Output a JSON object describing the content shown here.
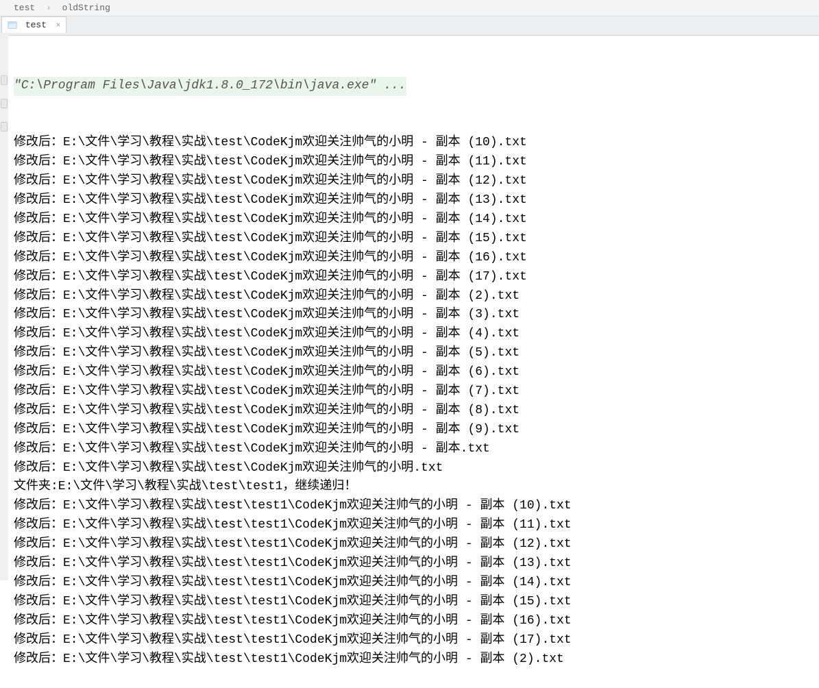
{
  "breadcrumb": {
    "item1": "test",
    "sep": "›",
    "item2": "oldString"
  },
  "tab": {
    "label": "test",
    "close_char": "×"
  },
  "console": {
    "command": "\"C:\\Program Files\\Java\\jdk1.8.0_172\\bin\\java.exe\" ...",
    "lines": [
      "修改后：E:\\文件\\学习\\教程\\实战\\test\\CodeKjm欢迎关注帅气的小明 - 副本 (10).txt",
      "修改后：E:\\文件\\学习\\教程\\实战\\test\\CodeKjm欢迎关注帅气的小明 - 副本 (11).txt",
      "修改后：E:\\文件\\学习\\教程\\实战\\test\\CodeKjm欢迎关注帅气的小明 - 副本 (12).txt",
      "修改后：E:\\文件\\学习\\教程\\实战\\test\\CodeKjm欢迎关注帅气的小明 - 副本 (13).txt",
      "修改后：E:\\文件\\学习\\教程\\实战\\test\\CodeKjm欢迎关注帅气的小明 - 副本 (14).txt",
      "修改后：E:\\文件\\学习\\教程\\实战\\test\\CodeKjm欢迎关注帅气的小明 - 副本 (15).txt",
      "修改后：E:\\文件\\学习\\教程\\实战\\test\\CodeKjm欢迎关注帅气的小明 - 副本 (16).txt",
      "修改后：E:\\文件\\学习\\教程\\实战\\test\\CodeKjm欢迎关注帅气的小明 - 副本 (17).txt",
      "修改后：E:\\文件\\学习\\教程\\实战\\test\\CodeKjm欢迎关注帅气的小明 - 副本 (2).txt",
      "修改后：E:\\文件\\学习\\教程\\实战\\test\\CodeKjm欢迎关注帅气的小明 - 副本 (3).txt",
      "修改后：E:\\文件\\学习\\教程\\实战\\test\\CodeKjm欢迎关注帅气的小明 - 副本 (4).txt",
      "修改后：E:\\文件\\学习\\教程\\实战\\test\\CodeKjm欢迎关注帅气的小明 - 副本 (5).txt",
      "修改后：E:\\文件\\学习\\教程\\实战\\test\\CodeKjm欢迎关注帅气的小明 - 副本 (6).txt",
      "修改后：E:\\文件\\学习\\教程\\实战\\test\\CodeKjm欢迎关注帅气的小明 - 副本 (7).txt",
      "修改后：E:\\文件\\学习\\教程\\实战\\test\\CodeKjm欢迎关注帅气的小明 - 副本 (8).txt",
      "修改后：E:\\文件\\学习\\教程\\实战\\test\\CodeKjm欢迎关注帅气的小明 - 副本 (9).txt",
      "修改后：E:\\文件\\学习\\教程\\实战\\test\\CodeKjm欢迎关注帅气的小明 - 副本.txt",
      "修改后：E:\\文件\\学习\\教程\\实战\\test\\CodeKjm欢迎关注帅气的小明.txt",
      "文件夹:E:\\文件\\学习\\教程\\实战\\test\\test1，继续递归！",
      "修改后：E:\\文件\\学习\\教程\\实战\\test\\test1\\CodeKjm欢迎关注帅气的小明 - 副本 (10).txt",
      "修改后：E:\\文件\\学习\\教程\\实战\\test\\test1\\CodeKjm欢迎关注帅气的小明 - 副本 (11).txt",
      "修改后：E:\\文件\\学习\\教程\\实战\\test\\test1\\CodeKjm欢迎关注帅气的小明 - 副本 (12).txt",
      "修改后：E:\\文件\\学习\\教程\\实战\\test\\test1\\CodeKjm欢迎关注帅气的小明 - 副本 (13).txt",
      "修改后：E:\\文件\\学习\\教程\\实战\\test\\test1\\CodeKjm欢迎关注帅气的小明 - 副本 (14).txt",
      "修改后：E:\\文件\\学习\\教程\\实战\\test\\test1\\CodeKjm欢迎关注帅气的小明 - 副本 (15).txt",
      "修改后：E:\\文件\\学习\\教程\\实战\\test\\test1\\CodeKjm欢迎关注帅气的小明 - 副本 (16).txt",
      "修改后：E:\\文件\\学习\\教程\\实战\\test\\test1\\CodeKjm欢迎关注帅气的小明 - 副本 (17).txt",
      "修改后：E:\\文件\\学习\\教程\\实战\\test\\test1\\CodeKjm欢迎关注帅气的小明 - 副本 (2).txt"
    ]
  }
}
